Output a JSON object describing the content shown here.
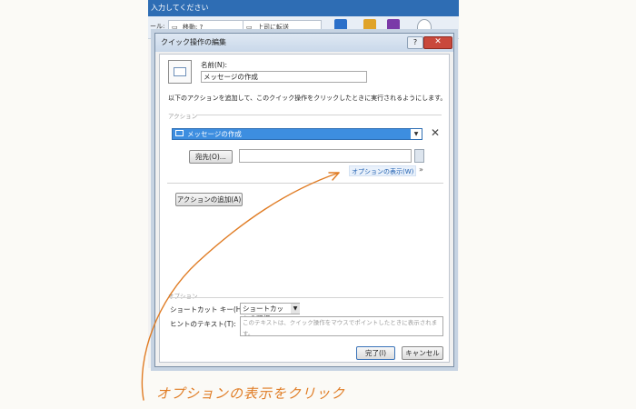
{
  "background": {
    "title_fragment": "入力してください",
    "toolbar_left": "ール:",
    "move_label": "移動: ?",
    "forward_label": "上司に転送"
  },
  "dialog": {
    "title": "クイック操作の編集",
    "help": "?",
    "close": "✕",
    "name_label": "名前(N):",
    "name_value": "メッセージの作成",
    "description": "以下のアクションを追加して、このクイック操作をクリックしたときに実行されるようにします。",
    "actions_group": "アクション",
    "action_selected": "メッセージの作成",
    "recipient_button": "宛先(O)...",
    "recipient_value": "",
    "show_options_link": "オプションの表示(W)",
    "show_options_chevron": "»",
    "add_action_button": "アクションの追加(A)",
    "options_group": "オプション",
    "shortcut_label": "ショートカット キー(H):",
    "shortcut_value": "ショートカットの選択",
    "hint_label": "ヒントのテキスト(T):",
    "hint_placeholder": "このテキストは、クイック操作をマウスでポイントしたときに表示されます。",
    "finish_button": "完了(I)",
    "cancel_button": "キャンセル"
  },
  "annotation": {
    "text": "オプションの表示をクリック",
    "color": "#e07c24"
  }
}
